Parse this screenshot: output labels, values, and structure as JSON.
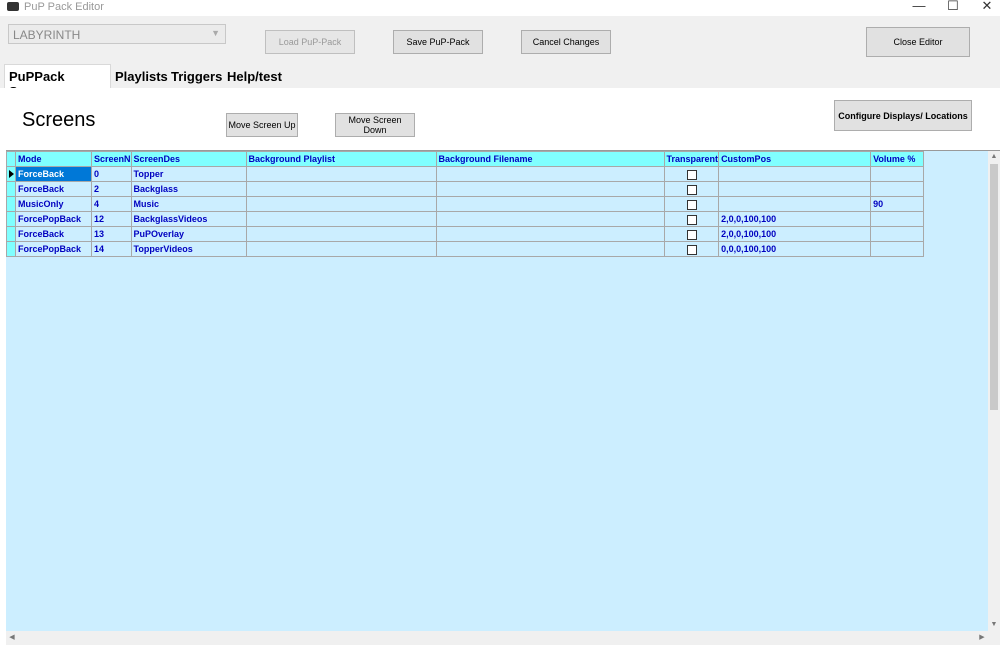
{
  "window": {
    "title": "PuP Pack Editor",
    "minimize": "—",
    "maximize": "☐",
    "close": "✕"
  },
  "toolbar": {
    "pack_select": "LABYRINTH",
    "load_label": "Load PuP-Pack",
    "save_label": "Save PuP-Pack",
    "cancel_label": "Cancel Changes",
    "close_label": "Close Editor"
  },
  "tabs": [
    "PuPPack Screens",
    "Playlists",
    "Triggers",
    "Help/test"
  ],
  "screens": {
    "heading": "Screens",
    "move_up_label": "Move Screen Up",
    "move_down_label": "Move Screen Down",
    "configure_label": "Configure Displays/ Locations"
  },
  "grid": {
    "columns": [
      "Mode",
      "ScreenN",
      "ScreenDes",
      "Background Playlist",
      "Background Filename",
      "Transparent",
      "CustomPos",
      "Volume %"
    ],
    "rows": [
      {
        "mode": "ForceBack",
        "screen": "0",
        "desc": "Topper",
        "bg_playlist": "",
        "bg_file": "",
        "transparent": false,
        "custompos": "",
        "volume": ""
      },
      {
        "mode": "ForceBack",
        "screen": "2",
        "desc": "Backglass",
        "bg_playlist": "",
        "bg_file": "",
        "transparent": false,
        "custompos": "",
        "volume": ""
      },
      {
        "mode": "MusicOnly",
        "screen": "4",
        "desc": "Music",
        "bg_playlist": "",
        "bg_file": "",
        "transparent": false,
        "custompos": "",
        "volume": "90"
      },
      {
        "mode": "ForcePopBack",
        "screen": "12",
        "desc": "BackglassVideos",
        "bg_playlist": "",
        "bg_file": "",
        "transparent": false,
        "custompos": "2,0,0,100,100",
        "volume": ""
      },
      {
        "mode": "ForceBack",
        "screen": "13",
        "desc": "PuPOverlay",
        "bg_playlist": "",
        "bg_file": "",
        "transparent": false,
        "custompos": "2,0,0,100,100",
        "volume": ""
      },
      {
        "mode": "ForcePopBack",
        "screen": "14",
        "desc": "TopperVideos",
        "bg_playlist": "",
        "bg_file": "",
        "transparent": false,
        "custompos": "0,0,0,100,100",
        "volume": ""
      }
    ]
  },
  "colors": {
    "header": "#80ffff",
    "cell": "#cceeff",
    "text": "#0000c0",
    "selection": "#0078d7"
  }
}
